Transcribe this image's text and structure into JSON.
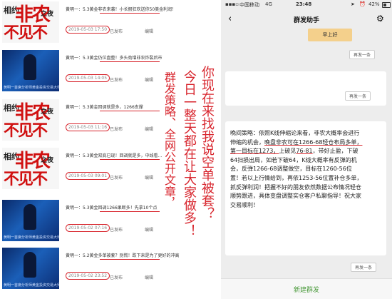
{
  "left_panel": {
    "rows": [
      {
        "thumb": "red",
        "title": "黄明一：5.3黄金非农来袭！小长假狂欢送你50美金利润！",
        "date": "2019-05-03 17:50",
        "status": "已发布",
        "action": "编辑"
      },
      {
        "thumb": "blue",
        "title": "黄明一：5.3黄金仍位盘整！多头劲增非农炸裂后市",
        "date": "2019-05-03 14:05",
        "status": "已发布",
        "action": "编辑"
      },
      {
        "thumb": "red",
        "title": "黄明一：5.3黄金回调就是多，1266支撑",
        "date": "2019-05-03 11:16",
        "status": "已发布",
        "action": "编辑"
      },
      {
        "thumb": "red",
        "title": "黄明一：5.3黄金双底已现！回调就是多，中线看...",
        "date": "2019-05-03 09:01",
        "status": "已发布",
        "action": "编辑"
      },
      {
        "thumb": "blue",
        "title": "黄明一：5.3黄金回调1266果断多！先拿10个点",
        "date": "2019-05-02 07:16",
        "status": "已发布",
        "action": "编辑"
      },
      {
        "thumb": "blue",
        "title": "黄明一：5.2黄金多单被套？别慌！跌下来是为了更好的冲高",
        "date": "2019-05-02 23:52",
        "status": "已发布",
        "action": "编辑"
      }
    ],
    "thumb_red": {
      "a": "相约",
      "b": "非农",
      "c": "之夜",
      "d": "不见不散"
    },
    "thumb_blue_caption": "黄明一首席分析师黄金投资交易大师"
  },
  "overlay": {
    "col1": "你现在来找我说空单被套？",
    "col2": "今日一整天都在让大家做多！",
    "col3": "群发策略、全网公开文章，"
  },
  "phone": {
    "status": {
      "carrier": "中国移动",
      "network": "4G",
      "time": "23:48",
      "battery": "42%"
    },
    "title": "群发助手",
    "top_label": "早上好",
    "repost": "再发一条",
    "message": {
      "p1": "晚间策略：依照K线伸缩论来看，非农大概率会进行伸缩的机会，",
      "u1": "晚盘非农可在1266-68轻仓布局多单，第一目标在1273，",
      "p2": "上破见",
      "u2": "76-81",
      "p3": "，带好止盈，下破64扫损出局，如若下破64，K线大概率有反弹的机会，反弹1266-68调整做空，目标在1260-56位置！若以上行情给到，再依1253-56位置补仓多单，抓反弹利润！把握不好的朋友依然数据公布情况轻仓顺势跟进，具体变盘调整实仓客户私聊指导！祝大家交易顺利！"
    },
    "new_broadcast": "新建群发",
    "accent": "#4a9a3b"
  }
}
